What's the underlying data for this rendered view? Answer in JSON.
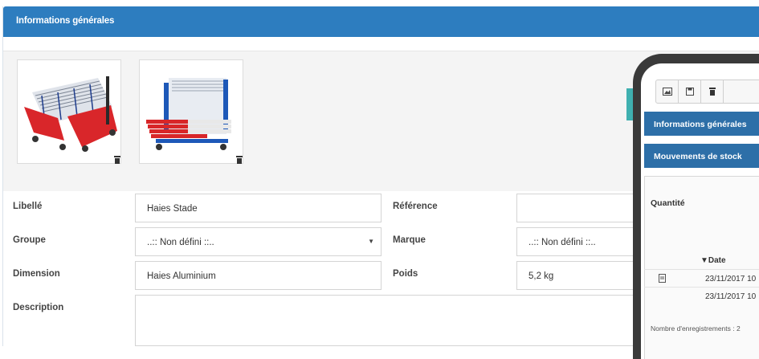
{
  "panel": {
    "title": "Informations générales"
  },
  "gallery": {
    "images": [
      {
        "alt": "hurdle-cart-red-white"
      },
      {
        "alt": "hurdle-cart-blue-red"
      }
    ]
  },
  "form": {
    "libelle": {
      "label": "Libellé",
      "value": "Haies Stade"
    },
    "reference": {
      "label": "Référence",
      "value": ""
    },
    "groupe": {
      "label": "Groupe",
      "value": "..:: Non défini ::.."
    },
    "marque": {
      "label": "Marque",
      "value": "..:: Non défini ::.."
    },
    "dimension": {
      "label": "Dimension",
      "value": "Haies Aluminium"
    },
    "poids": {
      "label": "Poids",
      "value": "5,2 kg"
    },
    "description": {
      "label": "Description",
      "value": ""
    }
  },
  "tablet": {
    "section_info": "Informations générales",
    "section_stock": "Mouvements de stock",
    "quantite_label": "Quantité",
    "col_date": "▼Date",
    "rows": [
      {
        "date": "23/11/2017 10"
      },
      {
        "date": "23/11/2017 10"
      }
    ],
    "footer": "Nombre d'enregistrements : 2"
  },
  "colors": {
    "header": "#2d7dbf",
    "tablet_section": "#2d6fa8"
  }
}
